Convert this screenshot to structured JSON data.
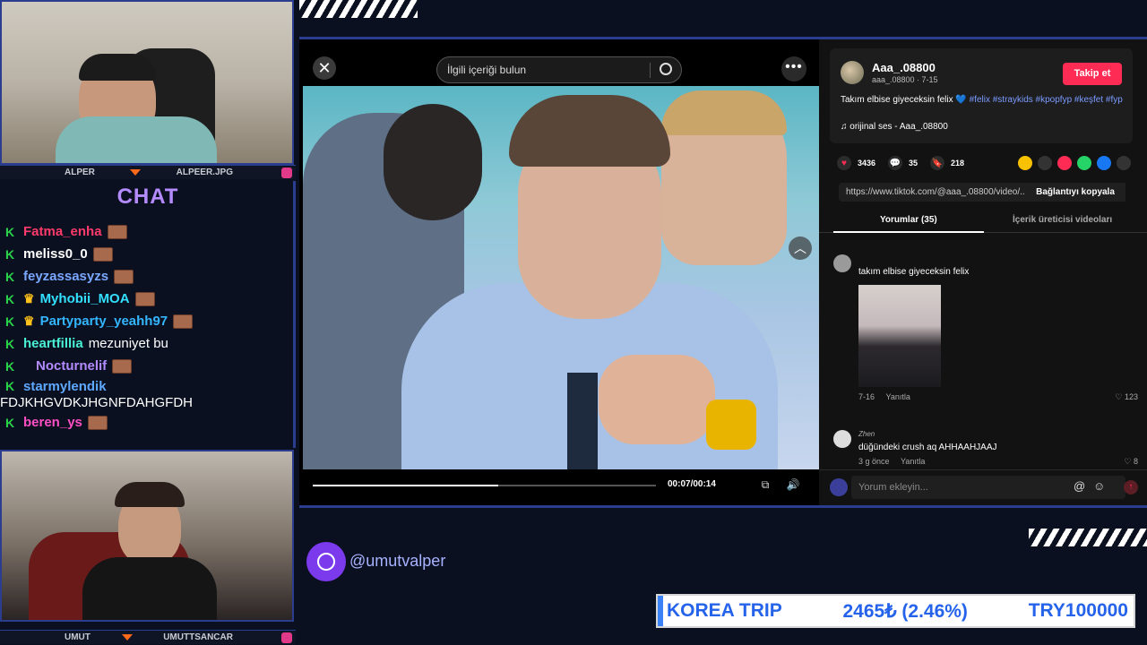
{
  "streamers": {
    "top": {
      "name": "ALPER",
      "handle": "ALPEER.JPG"
    },
    "bottom": {
      "name": "UMUT",
      "handle": "UMUTTSANCAR"
    }
  },
  "chat": {
    "title": "CHAT",
    "messages": [
      {
        "user": "Fatma_enha",
        "color": "#ff3b6b",
        "text": ""
      },
      {
        "user": "meliss0_0",
        "color": "#ffffff",
        "text": ""
      },
      {
        "user": "feyzassasyzs",
        "color": "#7aa7ff",
        "text": ""
      },
      {
        "user": "Myhobii_MOA",
        "color": "#33e0ff",
        "text": ""
      },
      {
        "user": "Partyparty_yeahh97",
        "color": "#33b6ff",
        "text": ""
      },
      {
        "user": "heartfillia",
        "color": "#49f0d6",
        "text": "mezuniyet bu"
      },
      {
        "user": "Nocturnelif",
        "color": "#b28bff",
        "text": ""
      },
      {
        "user": "starmylendik",
        "color": "#5ea8ff",
        "text": ""
      }
    ],
    "long_message": "FDJKHGVDKJHGNFDAHGFDH",
    "last_user": {
      "user": "beren_ys",
      "color": "#ff4fc4"
    }
  },
  "video": {
    "search_placeholder": "İlgili içeriği bulun",
    "time": "00:07/00:14",
    "progress": 0.54
  },
  "post": {
    "username": "Aaa_.08800",
    "sub": "aaa_.08800 · 7-15",
    "follow_label": "Takip et",
    "description": "Takım elbise giyeceksin felix 💙",
    "tags": "#felix #straykids #kpopfyp #keşfet #fyp",
    "sound": "orijinal ses - Aaa_.08800",
    "likes": "3436",
    "comments": "35",
    "saves": "218",
    "url": "https://www.tiktok.com/@aaa_.08800/video/...",
    "copy_label": "Bağlantıyı kopyala",
    "tab_comments": "Yorumlar (35)",
    "tab_creator": "İçerik üreticisi videoları"
  },
  "comments": [
    {
      "user": "",
      "text": "takım elbise giyeceksin felix",
      "date": "7-16",
      "reply": "Yanıtla",
      "likes": "123"
    },
    {
      "user": "Zhen",
      "text": "düğündeki crush aq AHHAAHJAAJ",
      "date": "3 g önce",
      "reply": "Yanıtla",
      "likes": "8"
    }
  ],
  "comment_input": {
    "placeholder": "Yorum ekleyin..."
  },
  "overlay": {
    "handle": "@umutvalper",
    "ticker_name": "KOREA TRIP",
    "ticker_value": "2465₺ (2.46%)",
    "ticker_goal": "TRY100000"
  }
}
